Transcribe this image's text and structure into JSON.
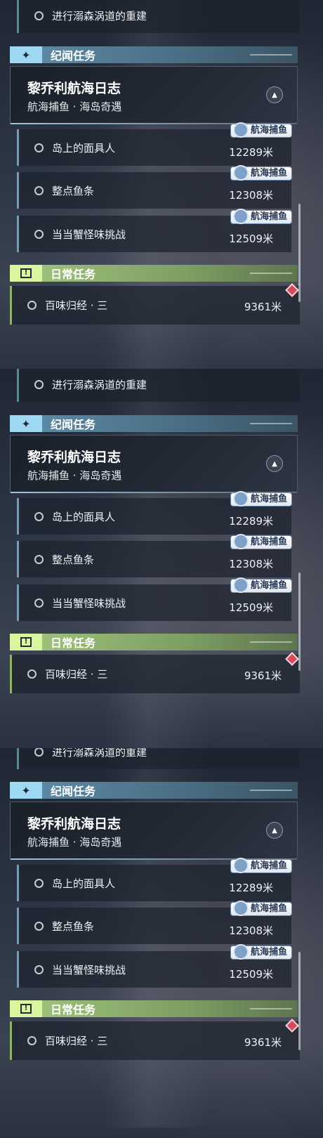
{
  "repeats": 3,
  "top_quest": {
    "label": "进行溺森涡道的重建"
  },
  "story_section": {
    "title": "纪闻任务",
    "badge_icon": "sparkle-icon",
    "card": {
      "title": "黎乔利航海日志",
      "subtitle": "航海捕鱼 · 海岛奇遇",
      "collapse_icon": "chevron-up-icon"
    },
    "items": [
      {
        "label": "岛上的面具人",
        "distance": "12289米",
        "tag": "航海捕鱼"
      },
      {
        "label": "整点鱼条",
        "distance": "12308米",
        "tag": "航海捕鱼"
      },
      {
        "label": "当当蟹怪味挑战",
        "distance": "12509米",
        "tag": "航海捕鱼"
      }
    ]
  },
  "daily_section": {
    "title": "日常任务",
    "badge_icon": "exclamation-box-icon",
    "items": [
      {
        "label": "百味归经 · 三",
        "distance": "9361米"
      }
    ]
  },
  "colors": {
    "story_accent": "#9fd8f2",
    "daily_accent": "#d9f59e",
    "alert": "#d64a5d"
  }
}
